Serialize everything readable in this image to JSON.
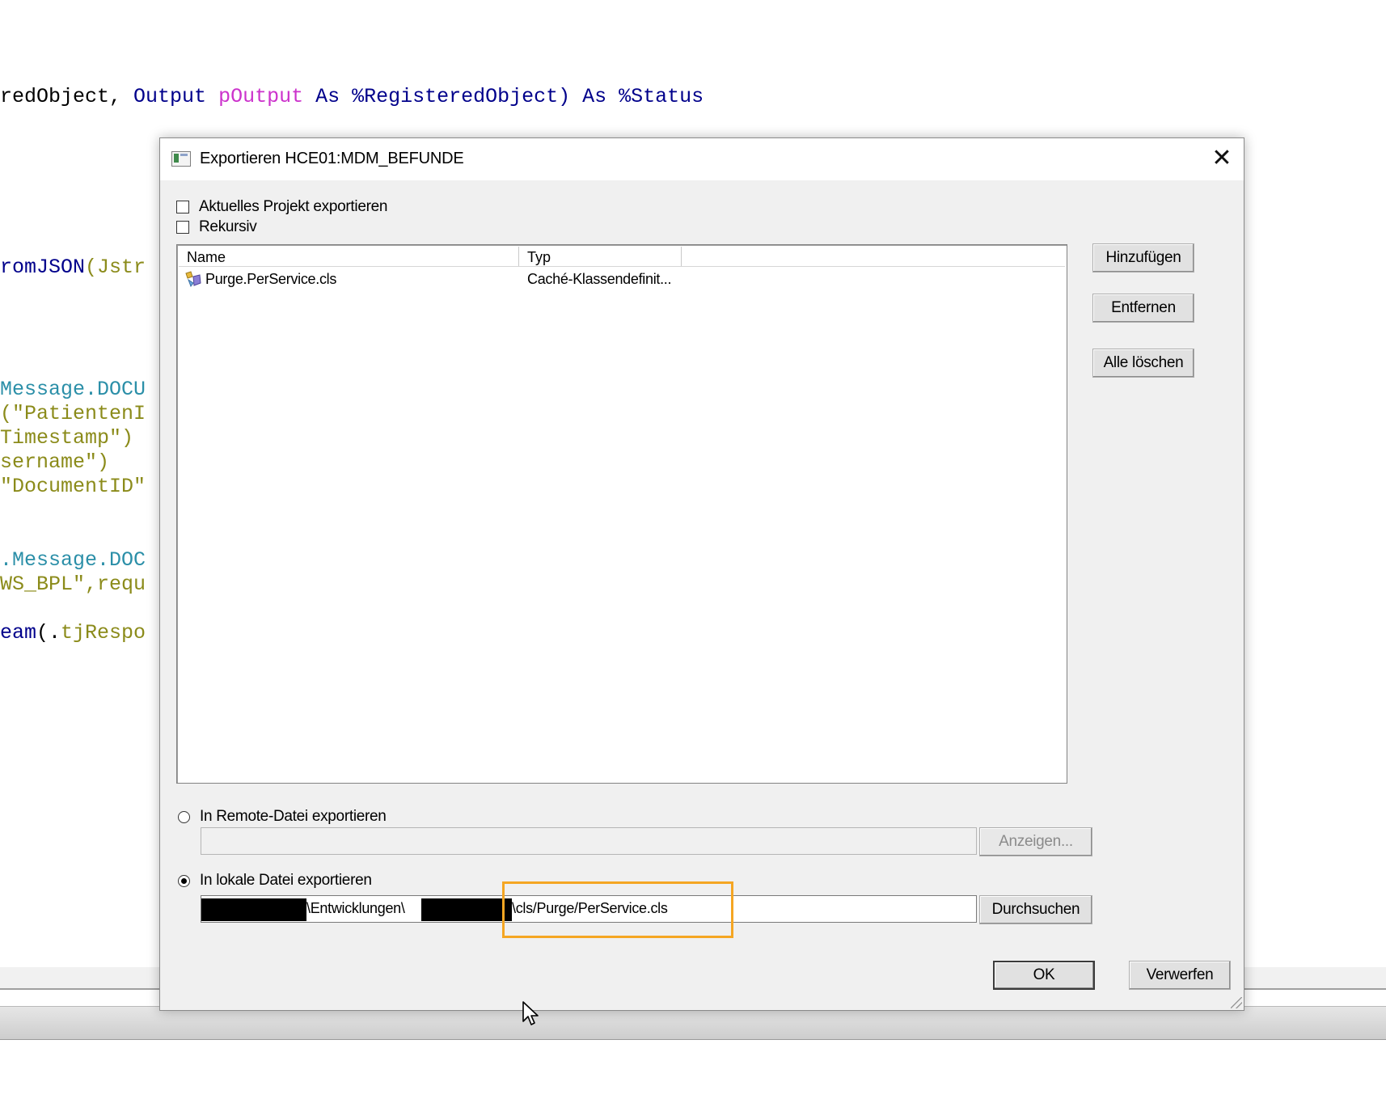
{
  "editor": {
    "line1": {
      "a": "redObject, ",
      "b": "Output ",
      "c": "pOutput ",
      "d": "As ",
      "e": "%RegisteredObject) ",
      "f": "As ",
      "g": "%Status"
    },
    "line2": {
      "a": "romJSON",
      "b": "(Jstr"
    },
    "line3": {
      "a": "Message.DOCU"
    },
    "line4": {
      "a": "(\"PatientenI"
    },
    "line5": {
      "a": "Timestamp\")"
    },
    "line6": {
      "a": "sername\")"
    },
    "line7": {
      "a": "\"DocumentID\""
    },
    "line8": {
      "a": ".Message.DOC"
    },
    "line9": {
      "a": "WS_BPL\"",
      "b": ",requ"
    },
    "line10": {
      "a": "eam",
      "b": "(.",
      "c": "tjRespo"
    }
  },
  "dialog": {
    "title": "Exportieren  HCE01:MDM_BEFUNDE",
    "close_label": "✕",
    "checkbox_current_project": "Aktuelles Projekt exportieren",
    "checkbox_recursive": "Rekursiv",
    "list": {
      "columns": [
        "Name",
        "Typ"
      ],
      "rows": [
        {
          "name": "Purge.PerService.cls",
          "type": "Caché-Klassendefinit..."
        }
      ]
    },
    "buttons": {
      "add": "Hinzufügen",
      "remove": "Entfernen",
      "clear_all": "Alle löschen",
      "show": "Anzeigen...",
      "browse": "Durchsuchen",
      "ok": "OK",
      "discard": "Verwerfen"
    },
    "radio_remote": "In Remote-Datei exportieren",
    "remote_path": "",
    "radio_local": "In lokale Datei exportieren",
    "local_path": {
      "segment1": "\\Entwicklungen\\",
      "segment2": "\\cls/Purge/PerService.cls"
    },
    "selected_export": "local"
  },
  "colors": {
    "highlight": "#f5a623",
    "keyword": "#00008b",
    "param": "#cc33cc",
    "method": "#2b8fa8",
    "string": "#8b8b1a"
  }
}
